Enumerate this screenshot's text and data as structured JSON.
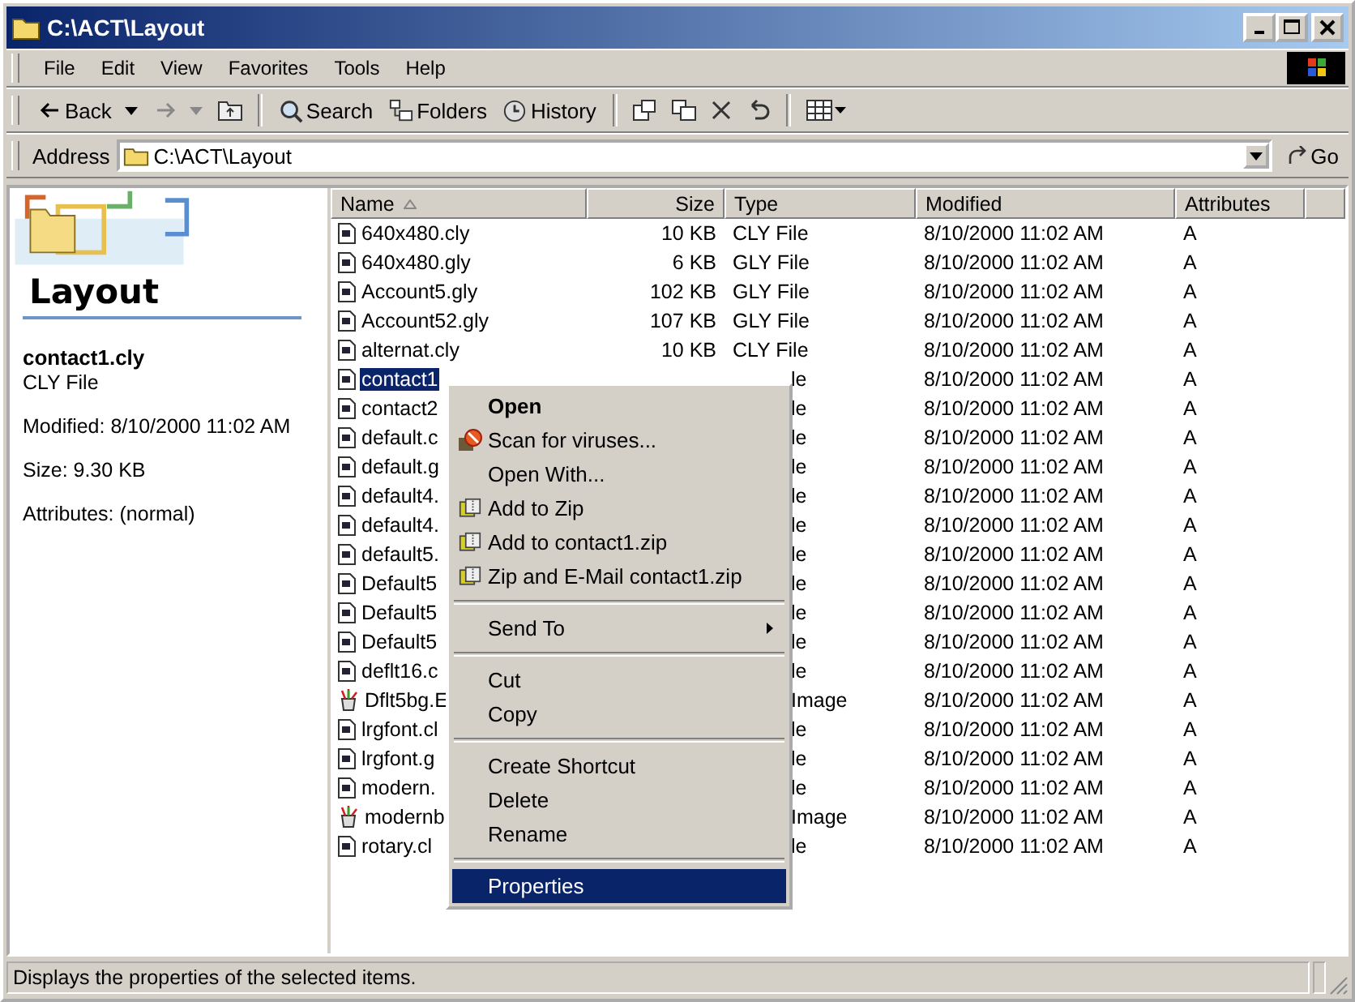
{
  "window": {
    "title": "C:\\ACT\\Layout"
  },
  "menu_bar": [
    "File",
    "Edit",
    "View",
    "Favorites",
    "Tools",
    "Help"
  ],
  "toolbar": [
    {
      "label": "Back",
      "kind": "back",
      "disabled": false
    },
    {
      "kind": "forward",
      "disabled": true
    },
    {
      "label": "Search",
      "kind": "search",
      "disabled": false
    },
    {
      "label": "Folders",
      "kind": "folders",
      "disabled": false
    },
    {
      "label": "History",
      "kind": "history",
      "disabled": false
    }
  ],
  "address": {
    "label": "Address",
    "value": "C:\\ACT\\Layout",
    "go": "Go"
  },
  "details_pane": {
    "title": "Layout",
    "file_name": "contact1.cly",
    "file_type": "CLY File",
    "modified": "Modified: 8/10/2000 11:02 AM",
    "size": "Size: 9.30 KB",
    "attributes": "Attributes: (normal)"
  },
  "table": {
    "columns": [
      "Name",
      "Size",
      "Type",
      "Modified",
      "Attributes"
    ],
    "rows": [
      {
        "kind": "doc",
        "name": "640x480.cly",
        "size": "10 KB",
        "type": "CLY File",
        "modified": "8/10/2000 11:02 AM",
        "attributes": "A",
        "selected": false
      },
      {
        "kind": "doc",
        "name": "640x480.gly",
        "size": "6 KB",
        "type": "GLY File",
        "modified": "8/10/2000 11:02 AM",
        "attributes": "A",
        "selected": false
      },
      {
        "kind": "doc",
        "name": "Account5.gly",
        "size": "102 KB",
        "type": "GLY File",
        "modified": "8/10/2000 11:02 AM",
        "attributes": "A",
        "selected": false
      },
      {
        "kind": "doc",
        "name": "Account52.gly",
        "size": "107 KB",
        "type": "GLY File",
        "modified": "8/10/2000 11:02 AM",
        "attributes": "A",
        "selected": false
      },
      {
        "kind": "doc",
        "name": "alternat.cly",
        "size": "10 KB",
        "type": "CLY File",
        "modified": "8/10/2000 11:02 AM",
        "attributes": "A",
        "selected": false
      },
      {
        "kind": "doc",
        "name": "contact1",
        "type": "le",
        "modified": "8/10/2000 11:02 AM",
        "attributes": "A",
        "selected": true
      },
      {
        "kind": "doc",
        "name": "contact2",
        "type": "le",
        "modified": "8/10/2000 11:02 AM",
        "attributes": "A",
        "selected": false
      },
      {
        "kind": "doc",
        "name": "default.c",
        "type": "le",
        "modified": "8/10/2000 11:02 AM",
        "attributes": "A",
        "selected": false
      },
      {
        "kind": "doc",
        "name": "default.g",
        "type": "le",
        "modified": "8/10/2000 11:02 AM",
        "attributes": "A",
        "selected": false
      },
      {
        "kind": "doc",
        "name": "default4.",
        "type": "le",
        "modified": "8/10/2000 11:02 AM",
        "attributes": "A",
        "selected": false
      },
      {
        "kind": "doc",
        "name": "default4.",
        "type": "le",
        "modified": "8/10/2000 11:02 AM",
        "attributes": "A",
        "selected": false
      },
      {
        "kind": "doc",
        "name": "default5.",
        "type": "le",
        "modified": "8/10/2000 11:02 AM",
        "attributes": "A",
        "selected": false
      },
      {
        "kind": "doc",
        "name": "Default5",
        "type": "le",
        "modified": "8/10/2000 11:02 AM",
        "attributes": "A",
        "selected": false
      },
      {
        "kind": "doc",
        "name": "Default5",
        "type": "le",
        "modified": "8/10/2000 11:02 AM",
        "attributes": "A",
        "selected": false
      },
      {
        "kind": "doc",
        "name": "Default5",
        "type": "le",
        "modified": "8/10/2000 11:02 AM",
        "attributes": "A",
        "selected": false
      },
      {
        "kind": "doc",
        "name": "deflt16.c",
        "type": "le",
        "modified": "8/10/2000 11:02 AM",
        "attributes": "A",
        "selected": false
      },
      {
        "kind": "bitmap",
        "name": "Dflt5bg.E",
        "type": "Image",
        "modified": "8/10/2000 11:02 AM",
        "attributes": "A",
        "selected": false
      },
      {
        "kind": "doc",
        "name": "lrgfont.cl",
        "type": "le",
        "modified": "8/10/2000 11:02 AM",
        "attributes": "A",
        "selected": false
      },
      {
        "kind": "doc",
        "name": "lrgfont.g",
        "type": "le",
        "modified": "8/10/2000 11:02 AM",
        "attributes": "A",
        "selected": false
      },
      {
        "kind": "doc",
        "name": "modern.",
        "type": "le",
        "modified": "8/10/2000 11:02 AM",
        "attributes": "A",
        "selected": false
      },
      {
        "kind": "bitmap",
        "name": "modernb",
        "type": "Image",
        "modified": "8/10/2000 11:02 AM",
        "attributes": "A",
        "selected": false
      },
      {
        "kind": "doc",
        "name": "rotary.cl",
        "type": "le",
        "modified": "8/10/2000 11:02 AM",
        "attributes": "A",
        "selected": false
      }
    ]
  },
  "context_menu": [
    {
      "kind": "item",
      "label": "Open",
      "default": true,
      "selected": false
    },
    {
      "kind": "scan",
      "label": "Scan for viruses...",
      "default": false,
      "selected": false
    },
    {
      "kind": "item",
      "label": "Open With...",
      "default": false,
      "selected": false
    },
    {
      "kind": "zip",
      "label": "Add to Zip",
      "default": false,
      "selected": false
    },
    {
      "kind": "zip",
      "label": "Add to contact1.zip",
      "default": false,
      "selected": false
    },
    {
      "kind": "zip",
      "label": "Zip and E-Mail contact1.zip",
      "default": false,
      "selected": false
    },
    {
      "kind": "separator"
    },
    {
      "kind": "submenu",
      "label": "Send To",
      "default": false,
      "selected": false
    },
    {
      "kind": "separator"
    },
    {
      "kind": "item",
      "label": "Cut",
      "default": false,
      "selected": false
    },
    {
      "kind": "item",
      "label": "Copy",
      "default": false,
      "selected": false
    },
    {
      "kind": "separator"
    },
    {
      "kind": "item",
      "label": "Create Shortcut",
      "default": false,
      "selected": false
    },
    {
      "kind": "item",
      "label": "Delete",
      "default": false,
      "selected": false
    },
    {
      "kind": "item",
      "label": "Rename",
      "default": false,
      "selected": false
    },
    {
      "kind": "separator"
    },
    {
      "kind": "item",
      "label": "Properties",
      "default": false,
      "selected": true
    }
  ],
  "status_bar": "Displays the properties of the selected items."
}
